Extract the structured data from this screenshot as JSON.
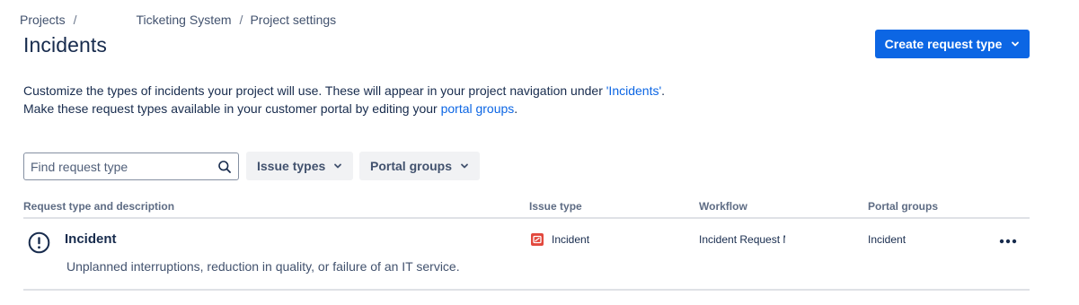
{
  "breadcrumb": {
    "items": [
      "Projects",
      "Ticketing System",
      "Project settings"
    ],
    "separator": "/"
  },
  "header": {
    "title": "Incidents",
    "create_button_label": "Create request type"
  },
  "description": {
    "line1_prefix": "Customize the types of incidents your project will use. These will appear in your project navigation under ",
    "line1_link": "'Incidents'",
    "line1_suffix": ".",
    "line2_prefix": "Make these request types available in your customer portal by editing your ",
    "line2_link": "portal groups",
    "line2_suffix": "."
  },
  "filters": {
    "search_placeholder": "Find request type",
    "issue_types_label": "Issue types",
    "portal_groups_label": "Portal groups"
  },
  "table": {
    "headers": [
      "Request type and description",
      "Issue type",
      "Workflow",
      "Portal groups"
    ],
    "rows": [
      {
        "name": "Incident",
        "description": "Unplanned interruptions, reduction in quality, or failure of an IT service.",
        "issue_type": "Incident",
        "workflow": "Incident Request Ma",
        "portal_groups": "Incident",
        "icon": "exclamation-circle-icon",
        "issue_type_icon": "incident-icon"
      }
    ]
  },
  "colors": {
    "primary": "#0c66e4",
    "incident_icon": "#e2483d",
    "text": "#172b4d",
    "subtle_text": "#42526e"
  }
}
